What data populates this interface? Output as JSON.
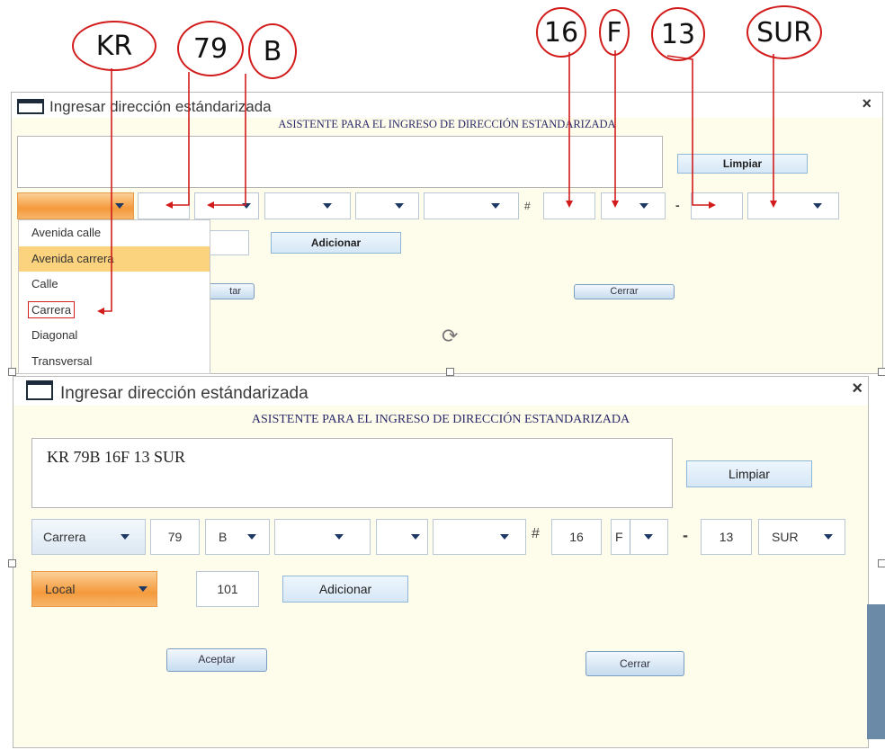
{
  "callouts": {
    "kr": "KR",
    "n79": "79",
    "b": "B",
    "n16": "16",
    "f": "F",
    "n13": "13",
    "sur": "SUR"
  },
  "dialog_top": {
    "title": "Ingresar dirección estándarizada",
    "close": "×",
    "subtitle": "ASISTENTE PARA EL INGRESO DE DIRECCIÓN ESTANDARIZADA",
    "clear_label": "Limpiar",
    "hash": "#",
    "dash": "-",
    "add_label": "Adicionar",
    "accept_label_partial": "tar",
    "close_label": "Cerrar",
    "dropdown_items": [
      "Avenida calle",
      "Avenida carrera",
      "Calle",
      "Carrera",
      "Diagonal",
      "Transversal"
    ]
  },
  "dialog_bottom": {
    "title": "Ingresar dirección estándarizada",
    "close": "×",
    "subtitle": "ASISTENTE PARA EL INGRESO DE DIRECCIÓN ESTANDARIZADA",
    "address_text": "KR 79B 16F 13 SUR",
    "clear_label": "Limpiar",
    "via_type": "Carrera",
    "via_number": "79",
    "via_letter": "B",
    "hash": "#",
    "cross_number": "16",
    "cross_letter_partial": "F",
    "dash": "-",
    "plate_number": "13",
    "quadrant": "SUR",
    "property_type": "Local",
    "property_number": "101",
    "add_label": "Adicionar",
    "accept_label": "Aceptar",
    "close_label": "Cerrar"
  },
  "colors": {
    "callout": "#d21c1c",
    "dialog_bg": "#fefcea",
    "highlight": "#fbd27d",
    "orange": "#f49a3c"
  },
  "icons": {
    "window": "window-icon",
    "rotate": "rotate-icon"
  }
}
